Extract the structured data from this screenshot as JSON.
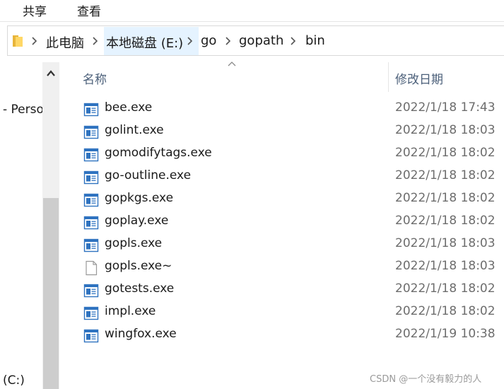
{
  "ribbon": {
    "tabs": [
      "共享",
      "查看"
    ]
  },
  "address": {
    "crumbs": [
      "此电脑",
      "本地磁盘 (E:)",
      "go",
      "gopath",
      "bin"
    ]
  },
  "nav": {
    "item_partial": "- Perso",
    "drive_partial": "(C:)"
  },
  "columns": {
    "name": "名称",
    "date": "修改日期"
  },
  "files": [
    {
      "name": "bee.exe",
      "date": "2022/1/18 17:43",
      "icon": "exe-icon"
    },
    {
      "name": "golint.exe",
      "date": "2022/1/18 18:03",
      "icon": "exe-icon"
    },
    {
      "name": "gomodifytags.exe",
      "date": "2022/1/18 18:02",
      "icon": "exe-icon"
    },
    {
      "name": "go-outline.exe",
      "date": "2022/1/18 18:02",
      "icon": "exe-icon"
    },
    {
      "name": "gopkgs.exe",
      "date": "2022/1/18 18:02",
      "icon": "exe-icon"
    },
    {
      "name": "goplay.exe",
      "date": "2022/1/18 18:02",
      "icon": "exe-icon"
    },
    {
      "name": "gopls.exe",
      "date": "2022/1/18 18:03",
      "icon": "exe-icon"
    },
    {
      "name": "gopls.exe~",
      "date": "2022/1/18 18:03",
      "icon": "blank-file-icon"
    },
    {
      "name": "gotests.exe",
      "date": "2022/1/18 18:02",
      "icon": "exe-icon"
    },
    {
      "name": "impl.exe",
      "date": "2022/1/18 18:02",
      "icon": "exe-icon"
    },
    {
      "name": "wingfox.exe",
      "date": "2022/1/19 10:38",
      "icon": "exe-icon"
    }
  ],
  "watermark": "CSDN @一个没有毅力的人",
  "colors": {
    "header_text": "#4c607a",
    "date_text": "#6d6d6d",
    "crumb_highlight": "#e5f3ff",
    "exe_blue": "#2f73c0"
  }
}
